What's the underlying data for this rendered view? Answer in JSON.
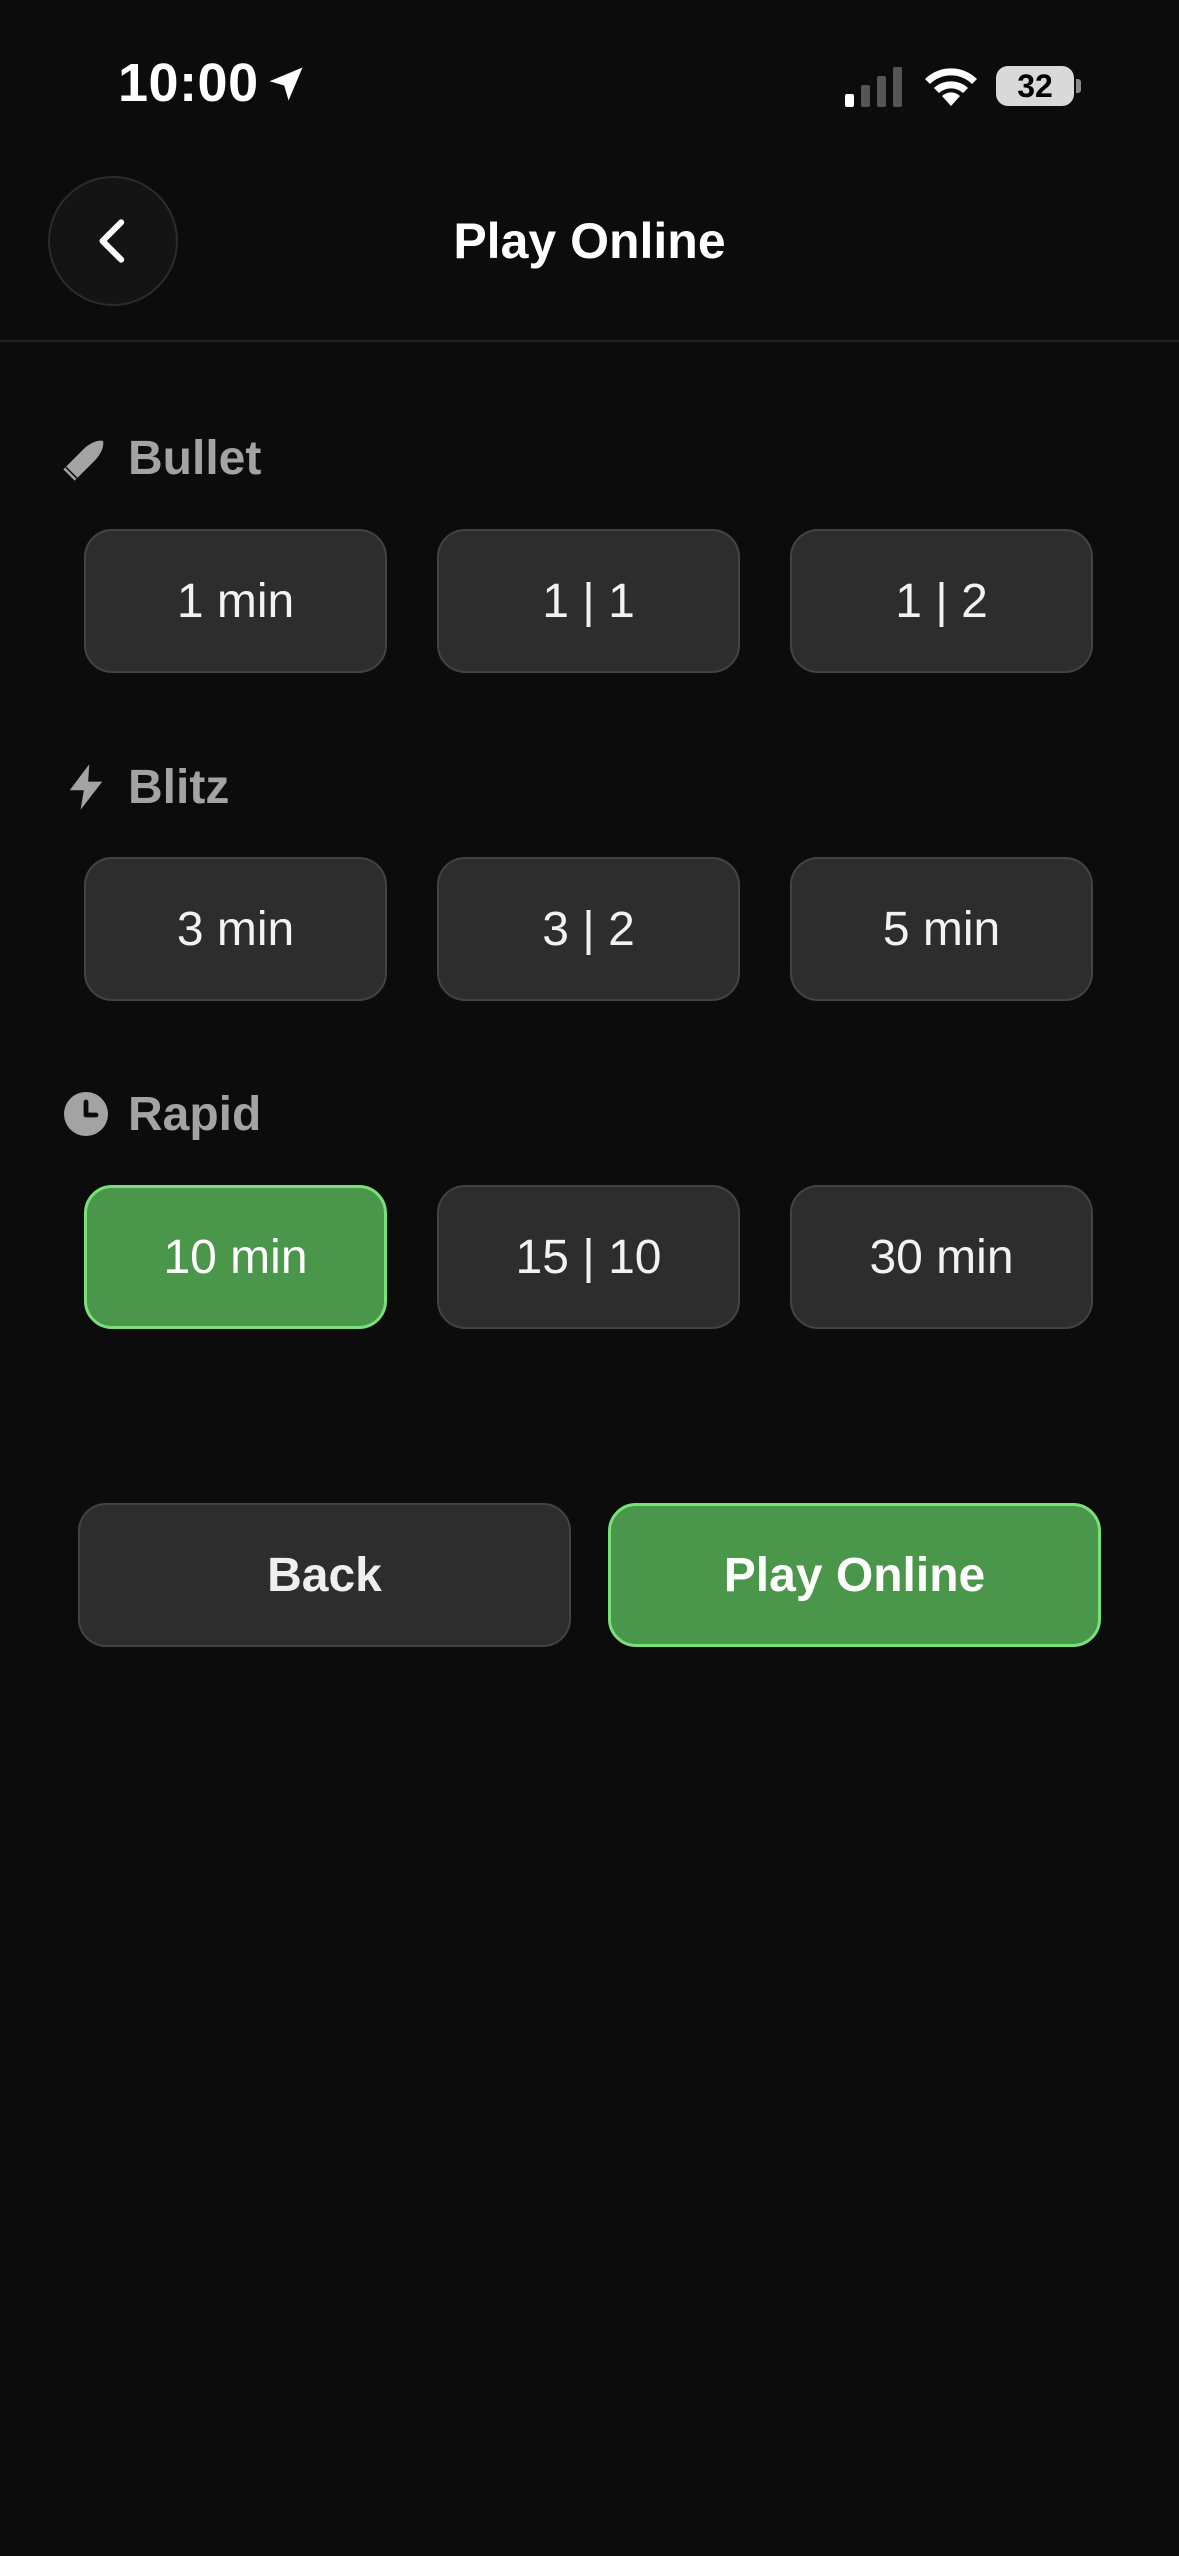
{
  "status_bar": {
    "time": "10:00",
    "battery_level": "32"
  },
  "header": {
    "title": "Play Online"
  },
  "sections": [
    {
      "label": "Bullet",
      "icon": "bullet-icon",
      "options": [
        "1 min",
        "1 | 1",
        "1 | 2"
      ]
    },
    {
      "label": "Blitz",
      "icon": "lightning-bolt-icon",
      "options": [
        "3 min",
        "3 | 2",
        "5 min"
      ]
    },
    {
      "label": "Rapid",
      "icon": "clock-icon",
      "options": [
        "10 min",
        "15 | 10",
        "30 min"
      ]
    }
  ],
  "selected_option": "10 min",
  "actions": {
    "back_label": "Back",
    "play_label": "Play Online"
  },
  "colors": {
    "background": "#0c0c0c",
    "button": "#2d2d2d",
    "accent_green": "#4a964a",
    "accent_border": "#7ae07a",
    "section_label": "#a3a3a3"
  }
}
